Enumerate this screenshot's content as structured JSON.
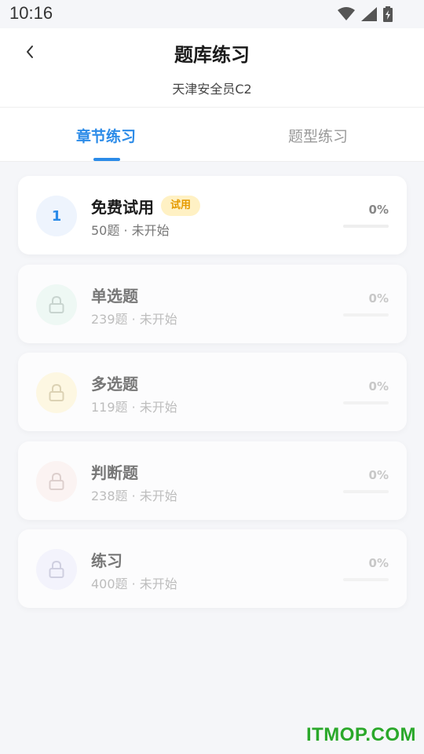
{
  "status_bar": {
    "time": "10:16"
  },
  "header": {
    "title": "题库练习",
    "subtitle": "天津安全员C2"
  },
  "tabs": [
    {
      "label": "章节练习",
      "active": true
    },
    {
      "label": "题型练习",
      "active": false
    }
  ],
  "chapters": [
    {
      "index": "1",
      "title": "免费试用",
      "badge": "试用",
      "count": "50题",
      "status": "未开始",
      "sub": "50题 · 未开始",
      "percent": "0%",
      "progress": 0,
      "locked": false,
      "icon_bg": "#eef4fd",
      "icon_color": "#2b8be8"
    },
    {
      "title": "单选题",
      "sub": "239题 · 未开始",
      "percent": "0%",
      "progress": 0,
      "locked": true,
      "icon": "lock-icon",
      "icon_bg": "#eef8f4",
      "icon_color": "#c8d4cf"
    },
    {
      "title": "多选题",
      "sub": "119题 · 未开始",
      "percent": "0%",
      "progress": 0,
      "locked": true,
      "icon": "lock-icon",
      "icon_bg": "#fdf7e2",
      "icon_color": "#dcd2b4"
    },
    {
      "title": "判断题",
      "sub": "238题 · 未开始",
      "percent": "0%",
      "progress": 0,
      "locked": true,
      "icon": "lock-icon",
      "icon_bg": "#fbf3f2",
      "icon_color": "#ddcfcd"
    },
    {
      "title": "练习",
      "sub": "400题 · 未开始",
      "percent": "0%",
      "progress": 0,
      "locked": true,
      "icon": "lock-icon",
      "icon_bg": "#f3f3fc",
      "icon_color": "#cfcfe0"
    }
  ],
  "watermark": "ITMOP.COM",
  "colors": {
    "accent": "#2b8be8",
    "badge_bg": "#fff1c4",
    "badge_text": "#e59a00",
    "background": "#f5f6f9"
  }
}
